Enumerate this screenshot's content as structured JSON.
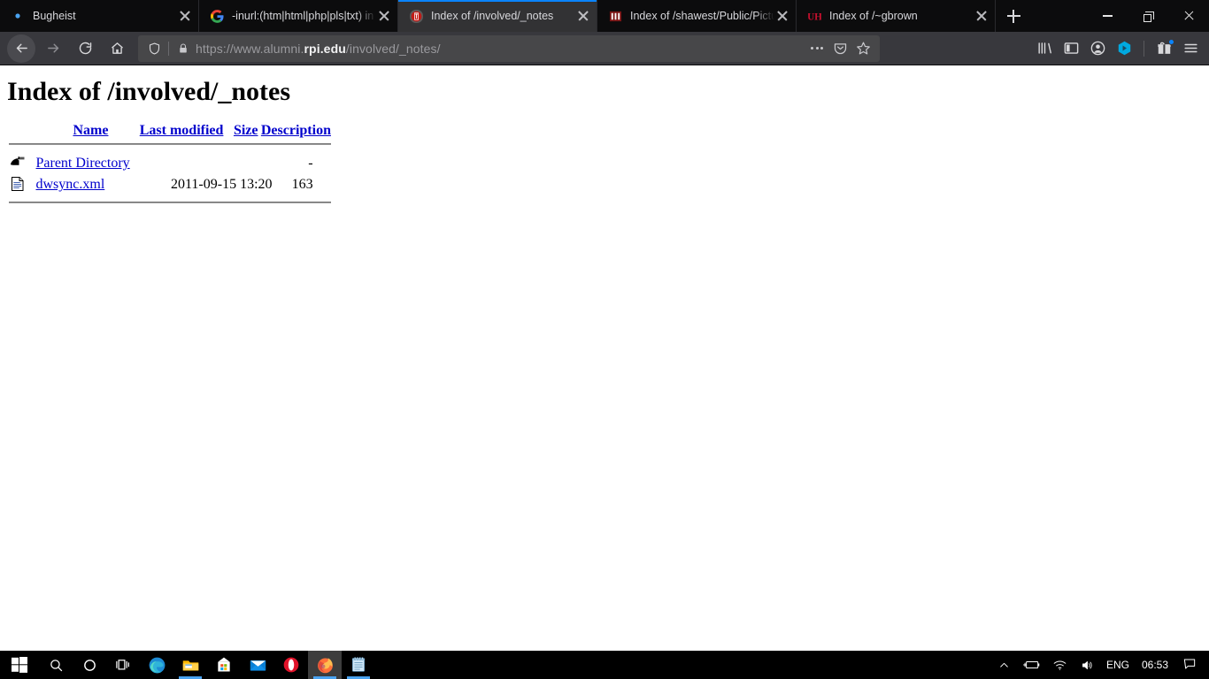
{
  "browser": {
    "tabs": [
      {
        "title": "Bugheist",
        "favicon": "bullet-icon",
        "active": false
      },
      {
        "title": "-inurl:(htm|html|php|pls|txt) in",
        "favicon": "google-icon",
        "active": false
      },
      {
        "title": "Index of /involved/_notes",
        "favicon": "rpi-seal-icon",
        "active": true
      },
      {
        "title": "Index of /shawest/Public/Pictu",
        "favicon": "bars-icon",
        "active": false
      },
      {
        "title": "Index of /~gbrown",
        "favicon": "uh-icon",
        "active": false
      }
    ],
    "new_tab_label": "+",
    "window_controls": {
      "minimize": "minimize-icon",
      "maximize": "restore-icon",
      "close": "close-icon"
    },
    "nav": {
      "back": "back-arrow-icon",
      "forward": "forward-arrow-icon",
      "reload": "reload-icon",
      "home": "home-icon"
    },
    "urlbar": {
      "shield": "tracking-protection-shield-icon",
      "lock": "padlock-icon",
      "url_prefix": "https://www.alumni.",
      "url_host_strong": "rpi.edu",
      "url_suffix": "/involved/_notes/",
      "page_actions": "ellipsis-icon",
      "pocket": "pocket-icon",
      "bookmark": "star-icon"
    },
    "toolbar_right": {
      "library": "library-icon",
      "sidebar": "sidebar-icon",
      "account": "account-icon",
      "extension": "extension-hexagon-icon",
      "gift": "gift-icon",
      "menu": "hamburger-menu-icon"
    },
    "accent_color": "#0a84ff"
  },
  "page": {
    "title": "Index of /involved/_notes",
    "link_color": "#0000cc",
    "columns": [
      {
        "label": "Name"
      },
      {
        "label": "Last modified"
      },
      {
        "label": "Size"
      },
      {
        "label": "Description"
      }
    ],
    "rows": [
      {
        "icon": "parent-directory-icon",
        "name": "Parent Directory",
        "modified": "",
        "size": "-",
        "description": ""
      },
      {
        "icon": "text-file-icon",
        "name": "dwsync.xml",
        "modified": "2011-09-15 13:20",
        "size": "163",
        "description": ""
      }
    ]
  },
  "taskbar": {
    "items": [
      {
        "name": "start-button",
        "icon": "windows-logo-icon"
      },
      {
        "name": "search-button",
        "icon": "search-icon"
      },
      {
        "name": "cortana-button",
        "icon": "cortana-circle-icon"
      },
      {
        "name": "task-view-button",
        "icon": "task-view-icon"
      },
      {
        "name": "edge-button",
        "icon": "edge-icon"
      },
      {
        "name": "file-explorer-button",
        "icon": "folder-icon"
      },
      {
        "name": "microsoft-store-button",
        "icon": "store-icon"
      },
      {
        "name": "mail-button",
        "icon": "mail-icon"
      },
      {
        "name": "opera-button",
        "icon": "opera-icon"
      },
      {
        "name": "firefox-button",
        "icon": "firefox-icon"
      },
      {
        "name": "notepad-button",
        "icon": "notepad-icon"
      }
    ],
    "tray": {
      "show_hidden": "chevron-up-icon",
      "battery": "battery-charging-icon",
      "network": "wifi-icon",
      "volume": "speaker-icon",
      "language": "ENG",
      "time": "06:53",
      "action_center": "notification-icon"
    }
  }
}
